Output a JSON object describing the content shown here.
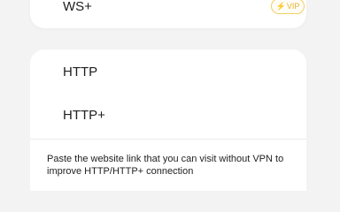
{
  "top_card": {
    "label": "WS+",
    "badge": "VIP",
    "badge_icon": "lightning-icon"
  },
  "protocol_list": {
    "items": [
      {
        "label": "HTTP"
      },
      {
        "label": "HTTP+"
      }
    ]
  },
  "help": {
    "text": "Paste the website link that you can visit without VPN to improve HTTP/HTTP+ connection"
  },
  "colors": {
    "background": "#f3f3f4",
    "card": "#ffffff",
    "text": "#202020",
    "vip": "#e3b532"
  }
}
